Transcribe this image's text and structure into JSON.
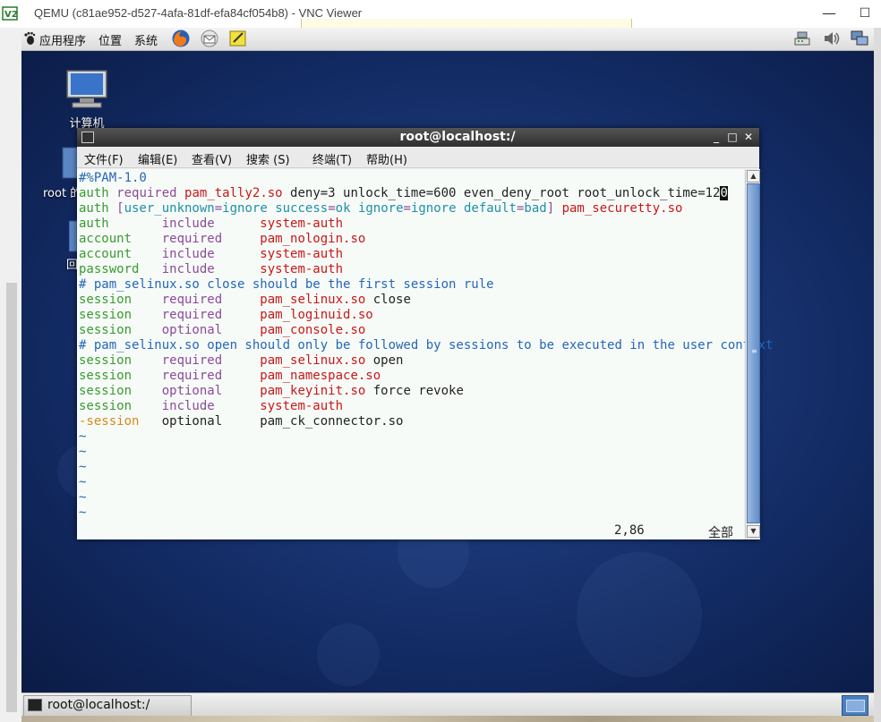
{
  "vnc": {
    "title": "QEMU (c81ae952-d527-4afa-81df-efa84cf054b8) - VNC Viewer",
    "minimize": "—",
    "maximize": "☐"
  },
  "top_panel": {
    "menus": [
      "应用程序",
      "位置",
      "系统"
    ]
  },
  "desktop_icons": [
    {
      "label": "计算机"
    },
    {
      "label": "root 的"
    },
    {
      "label": "回"
    }
  ],
  "terminal": {
    "title": "root@localhost:/",
    "buttons": {
      "minimize": "_",
      "maximize": "□",
      "close": "✕"
    },
    "menus": [
      "文件(F)",
      "编辑(E)",
      "查看(V)",
      "搜索 (S)",
      "终端(T)",
      "帮助(H)"
    ],
    "scroll_grip": "≡",
    "lines": [
      [
        {
          "t": "#%PAM-1.0",
          "c": "blue"
        }
      ],
      [
        {
          "t": "auth",
          "c": "green"
        },
        {
          "t": " ",
          "c": "black"
        },
        {
          "t": "required",
          "c": "purple"
        },
        {
          "t": " ",
          "c": "black"
        },
        {
          "t": "pam_tally2.so",
          "c": "red"
        },
        {
          "t": " deny=3 unlock_time=600 even_deny_root root_unlock_time=12",
          "c": "black"
        },
        {
          "t": "0",
          "c": "cursor"
        }
      ],
      [
        {
          "t": "auth",
          "c": "green"
        },
        {
          "t": " [",
          "c": "purple"
        },
        {
          "t": "user_unknown",
          "c": "cyan"
        },
        {
          "t": "=",
          "c": "purple"
        },
        {
          "t": "ignore",
          "c": "cyan"
        },
        {
          "t": " ",
          "c": "black"
        },
        {
          "t": "success",
          "c": "cyan"
        },
        {
          "t": "=",
          "c": "purple"
        },
        {
          "t": "ok",
          "c": "cyan"
        },
        {
          "t": " ",
          "c": "black"
        },
        {
          "t": "ignore",
          "c": "cyan"
        },
        {
          "t": "=",
          "c": "purple"
        },
        {
          "t": "ignore",
          "c": "cyan"
        },
        {
          "t": " ",
          "c": "black"
        },
        {
          "t": "default",
          "c": "cyan"
        },
        {
          "t": "=",
          "c": "purple"
        },
        {
          "t": "bad",
          "c": "cyan"
        },
        {
          "t": "] ",
          "c": "purple"
        },
        {
          "t": "pam_securetty.so",
          "c": "red"
        }
      ],
      [
        {
          "t": "auth       ",
          "c": "green"
        },
        {
          "t": "include      ",
          "c": "purple"
        },
        {
          "t": "system-auth",
          "c": "red"
        }
      ],
      [
        {
          "t": "account    ",
          "c": "green"
        },
        {
          "t": "required     ",
          "c": "purple"
        },
        {
          "t": "pam_nologin.so",
          "c": "red"
        }
      ],
      [
        {
          "t": "account    ",
          "c": "green"
        },
        {
          "t": "include      ",
          "c": "purple"
        },
        {
          "t": "system-auth",
          "c": "red"
        }
      ],
      [
        {
          "t": "password   ",
          "c": "green"
        },
        {
          "t": "include      ",
          "c": "purple"
        },
        {
          "t": "system-auth",
          "c": "red"
        }
      ],
      [
        {
          "t": "# pam_selinux.so close should be the first session rule",
          "c": "blue"
        }
      ],
      [
        {
          "t": "session    ",
          "c": "green"
        },
        {
          "t": "required     ",
          "c": "purple"
        },
        {
          "t": "pam_selinux.so",
          "c": "red"
        },
        {
          "t": " close",
          "c": "black"
        }
      ],
      [
        {
          "t": "session    ",
          "c": "green"
        },
        {
          "t": "required     ",
          "c": "purple"
        },
        {
          "t": "pam_loginuid.so",
          "c": "red"
        }
      ],
      [
        {
          "t": "session    ",
          "c": "green"
        },
        {
          "t": "optional     ",
          "c": "purple"
        },
        {
          "t": "pam_console.so",
          "c": "red"
        }
      ],
      [
        {
          "t": "# pam_selinux.so open should only be followed by sessions to be executed in the user context",
          "c": "blue"
        }
      ],
      [
        {
          "t": "session    ",
          "c": "green"
        },
        {
          "t": "required     ",
          "c": "purple"
        },
        {
          "t": "pam_selinux.so",
          "c": "red"
        },
        {
          "t": " open",
          "c": "black"
        }
      ],
      [
        {
          "t": "session    ",
          "c": "green"
        },
        {
          "t": "required     ",
          "c": "purple"
        },
        {
          "t": "pam_namespace.so",
          "c": "red"
        }
      ],
      [
        {
          "t": "session    ",
          "c": "green"
        },
        {
          "t": "optional     ",
          "c": "purple"
        },
        {
          "t": "pam_keyinit.so",
          "c": "red"
        },
        {
          "t": " force revoke",
          "c": "black"
        }
      ],
      [
        {
          "t": "session    ",
          "c": "green"
        },
        {
          "t": "include      ",
          "c": "purple"
        },
        {
          "t": "system-auth",
          "c": "red"
        }
      ],
      [
        {
          "t": "-session   ",
          "c": "orange"
        },
        {
          "t": "optional     ",
          "c": "black"
        },
        {
          "t": "pam_ck_connector.so",
          "c": "black"
        }
      ],
      [
        {
          "t": "~",
          "c": "blue"
        }
      ],
      [
        {
          "t": "~",
          "c": "blue"
        }
      ],
      [
        {
          "t": "~",
          "c": "blue"
        }
      ],
      [
        {
          "t": "~",
          "c": "blue"
        }
      ],
      [
        {
          "t": "~",
          "c": "blue"
        }
      ],
      [
        {
          "t": "~",
          "c": "blue"
        }
      ]
    ],
    "status_position": "2,86",
    "status_all": "全部"
  },
  "taskbar": {
    "task_label": "root@localhost:/"
  },
  "colors": {
    "blue": "#2566b8",
    "green": "#3a9a32",
    "purple": "#8c4a9a",
    "red": "#c81818",
    "black": "#222222",
    "orange": "#d58a1a",
    "cyan": "#1e8fa8"
  }
}
